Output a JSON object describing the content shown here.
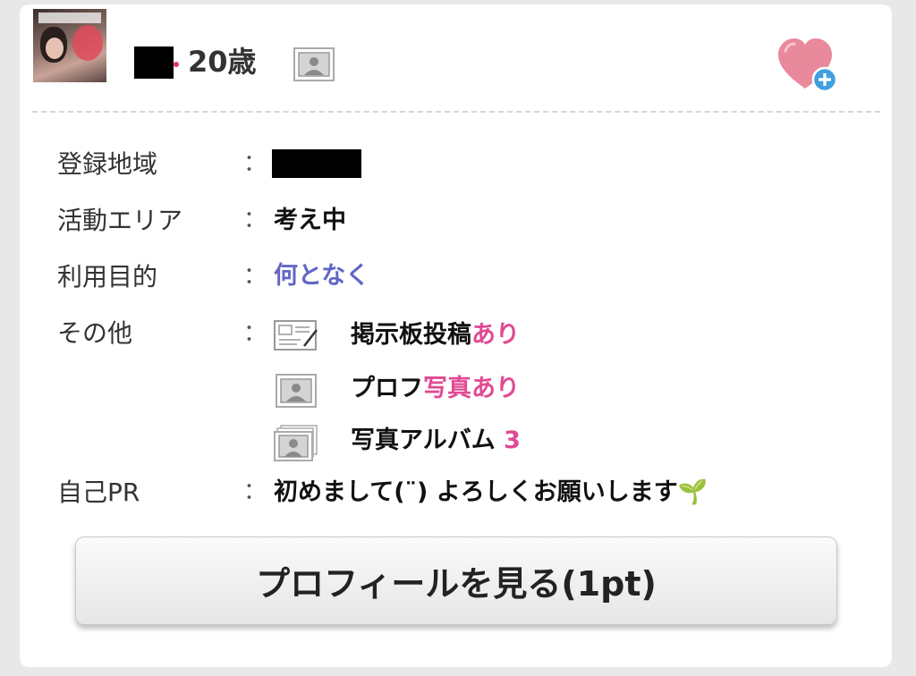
{
  "header": {
    "age": "20歳",
    "photo_badge_icon": "profile-photo-icon",
    "favorite_icon": "heart-plus-icon"
  },
  "details": {
    "colon": "：",
    "region": {
      "label": "登録地域",
      "value": ""
    },
    "activity_area": {
      "label": "活動エリア",
      "value": "考え中"
    },
    "purpose": {
      "label": "利用目的",
      "value": "何となく"
    },
    "other": {
      "label": "その他",
      "items": [
        {
          "icon": "bulletin-board-icon",
          "text": "掲示板投稿",
          "accent": "あり"
        },
        {
          "icon": "profile-photo-icon",
          "text": "プロフ",
          "accent": "写真あり"
        },
        {
          "icon": "photo-album-icon",
          "text": "写真アルバム",
          "accent": "3"
        }
      ]
    },
    "self_pr": {
      "label": "自己PR",
      "value": "初めまして(¨) よろしくお願いします🌱"
    }
  },
  "button": {
    "label": "プロフィールを見る(1pt)"
  },
  "colors": {
    "accent_pink": "#e04a93",
    "accent_purple": "#6366c4",
    "heart": "#e98a9c",
    "plus_badge": "#3f9fe0"
  }
}
